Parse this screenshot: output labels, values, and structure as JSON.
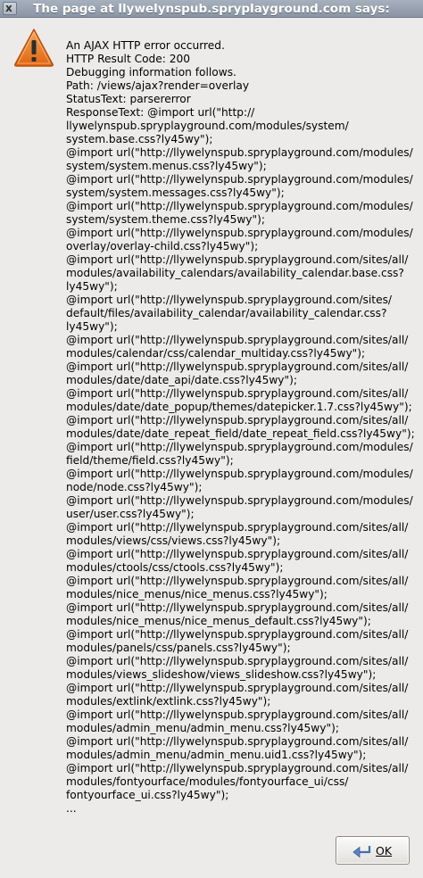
{
  "dialog": {
    "title": "The page at llywelynspub.spryplayground.com says:",
    "close_glyph": "x",
    "icon": "warning-triangle-icon",
    "message_lines": [
      "An AJAX HTTP error occurred.",
      "HTTP Result Code: 200",
      "Debugging information follows.",
      "Path: /views/ajax?render=overlay",
      "StatusText: parsererror",
      "ResponseText: @import url(\"http://",
      "llywelynspub.spryplayground.com/modules/system/",
      "system.base.css?ly45wy\");",
      "@import url(\"http://llywelynspub.spryplayground.com/modules/",
      "system/system.menus.css?ly45wy\");",
      "@import url(\"http://llywelynspub.spryplayground.com/modules/",
      "system/system.messages.css?ly45wy\");",
      "@import url(\"http://llywelynspub.spryplayground.com/modules/",
      "system/system.theme.css?ly45wy\");",
      "@import url(\"http://llywelynspub.spryplayground.com/modules/",
      "overlay/overlay-child.css?ly45wy\");",
      "@import url(\"http://llywelynspub.spryplayground.com/sites/all/",
      "modules/availability_calendars/availability_calendar.base.css?",
      "ly45wy\");",
      "@import url(\"http://llywelynspub.spryplayground.com/sites/",
      "default/files/availability_calendar/availability_calendar.css?",
      "ly45wy\");",
      "@import url(\"http://llywelynspub.spryplayground.com/sites/all/",
      "modules/calendar/css/calendar_multiday.css?ly45wy\");",
      "@import url(\"http://llywelynspub.spryplayground.com/sites/all/",
      "modules/date/date_api/date.css?ly45wy\");",
      "@import url(\"http://llywelynspub.spryplayground.com/sites/all/",
      "modules/date/date_popup/themes/datepicker.1.7.css?ly45wy\");",
      "@import url(\"http://llywelynspub.spryplayground.com/sites/all/",
      "modules/date/date_repeat_field/date_repeat_field.css?ly45wy\");",
      "@import url(\"http://llywelynspub.spryplayground.com/modules/",
      "field/theme/field.css?ly45wy\");",
      "@import url(\"http://llywelynspub.spryplayground.com/modules/",
      "node/node.css?ly45wy\");",
      "@import url(\"http://llywelynspub.spryplayground.com/modules/",
      "user/user.css?ly45wy\");",
      "@import url(\"http://llywelynspub.spryplayground.com/sites/all/",
      "modules/views/css/views.css?ly45wy\");",
      "@import url(\"http://llywelynspub.spryplayground.com/sites/all/",
      "modules/ctools/css/ctools.css?ly45wy\");",
      "@import url(\"http://llywelynspub.spryplayground.com/sites/all/",
      "modules/nice_menus/nice_menus.css?ly45wy\");",
      "@import url(\"http://llywelynspub.spryplayground.com/sites/all/",
      "modules/nice_menus/nice_menus_default.css?ly45wy\");",
      "@import url(\"http://llywelynspub.spryplayground.com/sites/all/",
      "modules/panels/css/panels.css?ly45wy\");",
      "@import url(\"http://llywelynspub.spryplayground.com/sites/all/",
      "modules/views_slideshow/views_slideshow.css?ly45wy\");",
      "@import url(\"http://llywelynspub.spryplayground.com/sites/all/",
      "modules/extlink/extlink.css?ly45wy\");",
      "@import url(\"http://llywelynspub.spryplayground.com/sites/all/",
      "modules/admin_menu/admin_menu.css?ly45wy\");",
      "@import url(\"http://llywelynspub.spryplayground.com/sites/all/",
      "modules/admin_menu/admin_menu.uid1.css?ly45wy\");",
      "@import url(\"http://llywelynspub.spryplayground.com/sites/all/",
      "modules/fontyourface/modules/fontyourface_ui/css/",
      "fontyourface_ui.css?ly45wy\");",
      "..."
    ],
    "ok_button": {
      "label": "OK",
      "icon": "return-arrow-icon"
    }
  },
  "colors": {
    "background": "#ecebe9",
    "titlebar": "#8a95a4",
    "warning_orange": "#e8731c"
  }
}
